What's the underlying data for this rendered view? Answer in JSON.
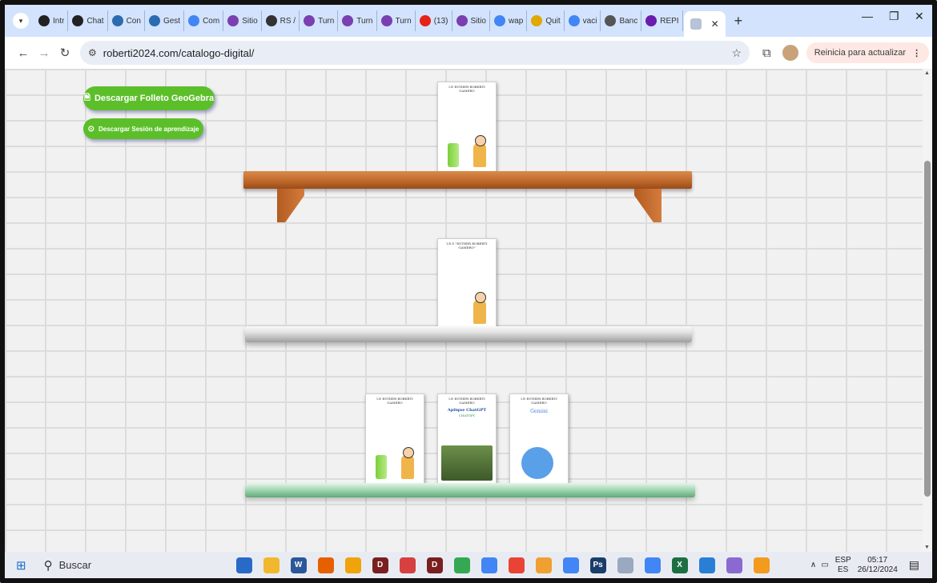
{
  "browser": {
    "tabs": [
      {
        "label": "Intr",
        "icon": "chatgpt-icon",
        "color": "#222222"
      },
      {
        "label": "Chat",
        "icon": "chatgpt-icon",
        "color": "#222222"
      },
      {
        "label": "Con",
        "icon": "gear-icon",
        "color": "#2b6cb0"
      },
      {
        "label": "Gest",
        "icon": "key-icon",
        "color": "#2b6cb0"
      },
      {
        "label": "Com",
        "icon": "google-icon",
        "color": "#4285f4"
      },
      {
        "label": "Sitio",
        "icon": "m-icon",
        "color": "#7a3fb0"
      },
      {
        "label": "RS /",
        "icon": "gear-icon",
        "color": "#333333"
      },
      {
        "label": "Turn",
        "icon": "n-icon",
        "color": "#7a3fb0"
      },
      {
        "label": "Turn",
        "icon": "n-icon",
        "color": "#7a3fb0"
      },
      {
        "label": "Turn",
        "icon": "n-icon",
        "color": "#7a3fb0"
      },
      {
        "label": "(13)",
        "icon": "youtube-icon",
        "color": "#e62117"
      },
      {
        "label": "Sitio",
        "icon": "m-icon",
        "color": "#7a3fb0"
      },
      {
        "label": "wap",
        "icon": "google-icon",
        "color": "#4285f4"
      },
      {
        "label": "Quit",
        "icon": "quiz-icon",
        "color": "#e0a800"
      },
      {
        "label": "vaci",
        "icon": "google-icon",
        "color": "#4285f4"
      },
      {
        "label": "Banc",
        "icon": "bank-icon",
        "color": "#555555"
      },
      {
        "label": "REPI",
        "icon": "yahoo-icon",
        "color": "#6a1bb0"
      }
    ],
    "active_tab_icon": "shelf-icon",
    "new_tab": "+",
    "url": "roberti2024.com/catalogo-digital/",
    "update_label": "Reinicia para actualizar"
  },
  "page": {
    "button_folleto": "Descargar Folleto GeoGebra",
    "button_sesion": "Descargar Sesión de aprendizaje",
    "books": {
      "book1_title": "I.E ESTHER ROBERTI GAMERO",
      "book2_title": "I.E.S \"ESTHER ROBERTI GAMERO\"",
      "book3_title": "I.E ESTHER ROBERTI GAMERO",
      "book4_title": "I.E ESTHER ROBERTI GAMERO",
      "book4_subtitle": "Aplique ChatGPT",
      "book4_badge": "CHATGPT",
      "book5_title": "I.E ESTHER ROBERTI GAMERO",
      "book5_subtitle": "Gemini"
    }
  },
  "taskbar": {
    "search_label": "Buscar",
    "lang_top": "ESP",
    "lang_bottom": "ES",
    "time": "05:17",
    "date": "26/12/2024",
    "apps": [
      {
        "name": "store-app",
        "color": "#2a6ac7",
        "glyph": ""
      },
      {
        "name": "file-explorer-app",
        "color": "#f2b72e",
        "glyph": ""
      },
      {
        "name": "word-app",
        "color": "#2b579a",
        "glyph": "W"
      },
      {
        "name": "firefox-app",
        "color": "#e66000",
        "glyph": ""
      },
      {
        "name": "chrome-app",
        "color": "#f0a30a",
        "glyph": ""
      },
      {
        "name": "davinci-app",
        "color": "#7a1f1f",
        "glyph": "D"
      },
      {
        "name": "record-app",
        "color": "#d64040",
        "glyph": ""
      },
      {
        "name": "davinci-app-2",
        "color": "#7a1f1f",
        "glyph": "D"
      },
      {
        "name": "chrome-profile-1",
        "color": "#34a853",
        "glyph": ""
      },
      {
        "name": "chrome-profile-2",
        "color": "#4285f4",
        "glyph": ""
      },
      {
        "name": "chrome-profile-3",
        "color": "#ea4335",
        "glyph": ""
      },
      {
        "name": "paint-app",
        "color": "#f0a030",
        "glyph": ""
      },
      {
        "name": "chrome-profile-4",
        "color": "#4285f4",
        "glyph": ""
      },
      {
        "name": "photoshop-app",
        "color": "#1b3d6b",
        "glyph": "Ps"
      },
      {
        "name": "pen-app",
        "color": "#9aa8c0",
        "glyph": ""
      },
      {
        "name": "chrome-profile-5",
        "color": "#4285f4",
        "glyph": ""
      },
      {
        "name": "excel-app",
        "color": "#1d6f42",
        "glyph": "X"
      },
      {
        "name": "presentation-app",
        "color": "#2a7fd4",
        "glyph": ""
      },
      {
        "name": "mascot-app",
        "color": "#8a6ad0",
        "glyph": ""
      },
      {
        "name": "music-app",
        "color": "#f29b1d",
        "glyph": ""
      }
    ]
  }
}
